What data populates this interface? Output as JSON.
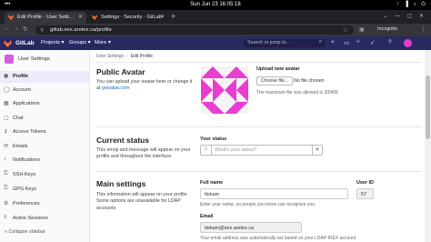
{
  "system": {
    "activities": "•••",
    "clock": "Sun Jun 23  16:05:18",
    "tray_icons": "↑ ▐ ♪ ⏻"
  },
  "browser": {
    "tabs": [
      {
        "title": "Edit Profile · User Setti…",
        "active": true
      },
      {
        "title": "Settings · Security · GitLab",
        "active": false
      }
    ],
    "new_tab": "+",
    "url": "gitlab.irex.aretex.ca/profile",
    "incognito": "Incognito"
  },
  "gitlab_nav": {
    "brand": "GitLab",
    "items": [
      "Projects ▾",
      "Groups ▾",
      "More ▾"
    ],
    "search_placeholder": "Search or jump to...",
    "icons": [
      "plus-icon",
      "issues-icon",
      "merge-request-icon",
      "todo-icon",
      "help-icon"
    ]
  },
  "sidebar": {
    "title": "User Settings",
    "items": [
      {
        "label": "Profile",
        "icon": "user-icon",
        "active": true
      },
      {
        "label": "Account",
        "icon": "account-icon"
      },
      {
        "label": "Applications",
        "icon": "applications-icon"
      },
      {
        "label": "Chat",
        "icon": "chat-icon"
      },
      {
        "label": "Access Tokens",
        "icon": "key-icon"
      },
      {
        "label": "Emails",
        "icon": "mail-icon"
      },
      {
        "label": "Notifications",
        "icon": "bell-icon"
      },
      {
        "label": "SSH Keys",
        "icon": "ssh-key-icon"
      },
      {
        "label": "GPG Keys",
        "icon": "gpg-key-icon"
      },
      {
        "label": "Preferences",
        "icon": "preferences-icon"
      },
      {
        "label": "Active Sessions",
        "icon": "sessions-icon"
      }
    ],
    "collapse": "«  Collapse sidebar"
  },
  "main": {
    "breadcrumb": [
      "User Settings",
      "Edit Profile"
    ],
    "avatar": {
      "heading": "Public Avatar",
      "desc_prefix": "You can upload your avatar here or change it at ",
      "desc_link": "gravatar.com",
      "upload_label": "Upload new avatar",
      "choose_button": "Choose file...",
      "no_file": "No file chosen",
      "max_size": "The maximum file size allowed is 200KB."
    },
    "status": {
      "heading": "Current status",
      "desc": "This emoji and message will appear on your profile and throughout the interface.",
      "label": "Your status",
      "placeholder": "What's your status?"
    },
    "main_settings": {
      "heading": "Main settings",
      "desc": "This information will appear on your profile Some options are unavailable for LDAP accounts",
      "full_name_label": "Full name",
      "full_name_value": "ttekam",
      "full_name_help": "Enter your name, so people you know can recognize you",
      "user_id_label": "User ID",
      "user_id_value": "57",
      "email_label": "Email",
      "email_value": "ttekam@irex.aretex.ca",
      "email_help": "Your email address was automatically set based on your LDAP-IREX account"
    }
  },
  "colors": {
    "gitlab_nav": "#292961",
    "avatar_pink": "#e83ecf",
    "link": "#1068bf",
    "active_item": "#ebebfa"
  }
}
